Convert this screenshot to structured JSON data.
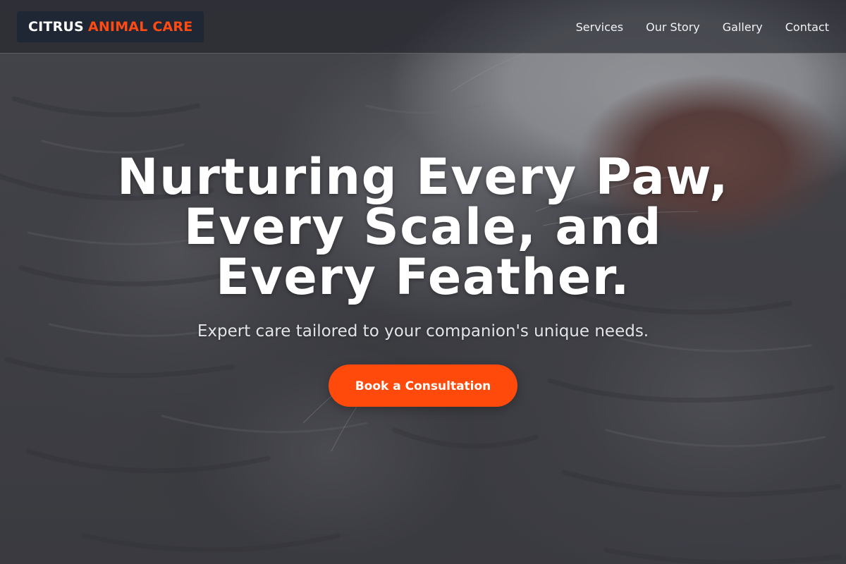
{
  "header": {
    "logo_part1": "CITRUS",
    "logo_part2": "ANIMAL CARE",
    "nav": [
      "Services",
      "Our Story",
      "Gallery",
      "Contact"
    ]
  },
  "hero": {
    "title_lines": [
      "Nurturing Every Paw,",
      "Every Scale, and",
      "Every Feather."
    ],
    "subtitle": "Expert care tailored to your companion's unique needs.",
    "cta_label": "Book a Consultation"
  },
  "colors": {
    "accent": "#ff4a0b",
    "logo_bg": "#1f2735",
    "header_bg": "#22242c"
  }
}
